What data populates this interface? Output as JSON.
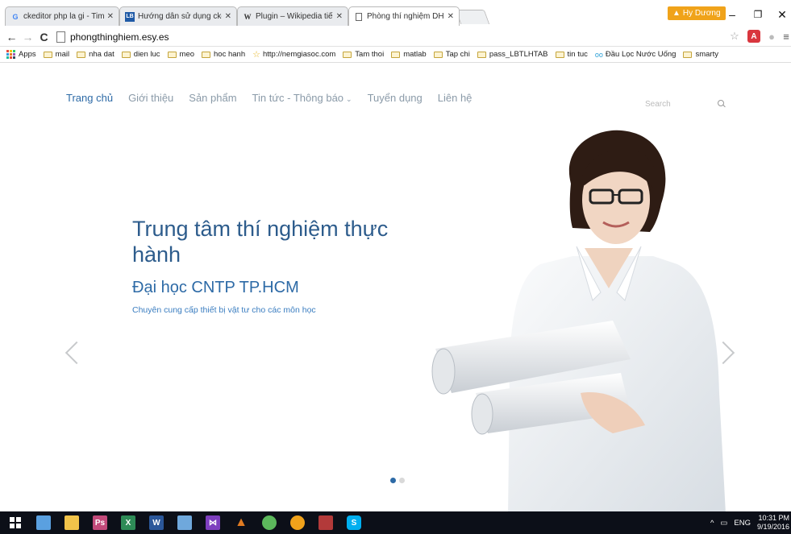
{
  "browser": {
    "tabs": [
      {
        "icon": "google-icon",
        "title": "ckeditor php la gi - Tim v"
      },
      {
        "icon": "lb-icon",
        "title": "Hướng dẫn sử dụng cked"
      },
      {
        "icon": "wikipedia-icon",
        "title": "Plugin – Wikipedia tiếng"
      },
      {
        "icon": "page-icon",
        "title": "Phòng thí nghiệm DH CN"
      }
    ],
    "active_tab": 3,
    "user_badge": "Hy Dương",
    "url": "phongthinghiem.esy.es",
    "bookmarks": [
      {
        "icon": "apps-icon",
        "label": "Apps"
      },
      {
        "icon": "folder-icon",
        "label": "mail"
      },
      {
        "icon": "folder-icon",
        "label": "nha dat"
      },
      {
        "icon": "folder-icon",
        "label": "dien luc"
      },
      {
        "icon": "folder-icon",
        "label": "meo"
      },
      {
        "icon": "folder-icon",
        "label": "hoc hanh"
      },
      {
        "icon": "star-icon",
        "label": "http://nemgiasoc.com"
      },
      {
        "icon": "folder-icon",
        "label": "Tam thoi"
      },
      {
        "icon": "folder-icon",
        "label": "matlab"
      },
      {
        "icon": "folder-icon",
        "label": "Tap chi"
      },
      {
        "icon": "folder-icon",
        "label": "pass_LBTLHTAB"
      },
      {
        "icon": "folder-icon",
        "label": "tin tuc"
      },
      {
        "icon": "glasses-icon",
        "label": "Đầu Lọc Nước Uống"
      },
      {
        "icon": "folder-icon",
        "label": "smarty"
      }
    ]
  },
  "site": {
    "nav": [
      {
        "label": "Trang chủ",
        "active": true
      },
      {
        "label": "Giới thiệu"
      },
      {
        "label": "Sản phẩm"
      },
      {
        "label": "Tin tức - Thông báo",
        "dropdown": true
      },
      {
        "label": "Tuyển dụng"
      },
      {
        "label": "Liên hệ"
      }
    ],
    "search_placeholder": "Search",
    "hero": {
      "title": "Trung tâm thí nghiệm thực hành",
      "subtitle": "Đại học CNTP TP.HCM",
      "description": "Chuyên cung cấp thiết bị vật tư cho các môn học"
    },
    "slides": 2,
    "active_slide": 0
  },
  "taskbar": {
    "apps": [
      {
        "icon": "windows-start-icon",
        "color": "#ffffff"
      },
      {
        "icon": "cortana-icon",
        "color": "#5aa0e0"
      },
      {
        "icon": "file-explorer-icon",
        "color": "#f1c34a"
      },
      {
        "icon": "photoshop-icon",
        "color": "#c24a7a"
      },
      {
        "icon": "excel-icon",
        "color": "#2e8b57"
      },
      {
        "icon": "word-icon",
        "color": "#2b579a"
      },
      {
        "icon": "notes-icon",
        "color": "#6fa8dc"
      },
      {
        "icon": "visual-studio-icon",
        "color": "#7e3fbf"
      },
      {
        "icon": "matlab-icon",
        "color": "#e07b22"
      },
      {
        "icon": "green-app-icon",
        "color": "#5cb85c"
      },
      {
        "icon": "chrome-icon",
        "color": "#f0a21b"
      },
      {
        "icon": "media-icon",
        "color": "#b33a3a"
      },
      {
        "icon": "skype-icon",
        "color": "#00aff0"
      }
    ],
    "tray": {
      "language": "ENG",
      "time": "10:31 PM",
      "date": "9/19/2016"
    }
  },
  "colors": {
    "accent": "#2d6aa6",
    "taskbar": "#0c0f18",
    "user_badge": "#f0a31a"
  }
}
